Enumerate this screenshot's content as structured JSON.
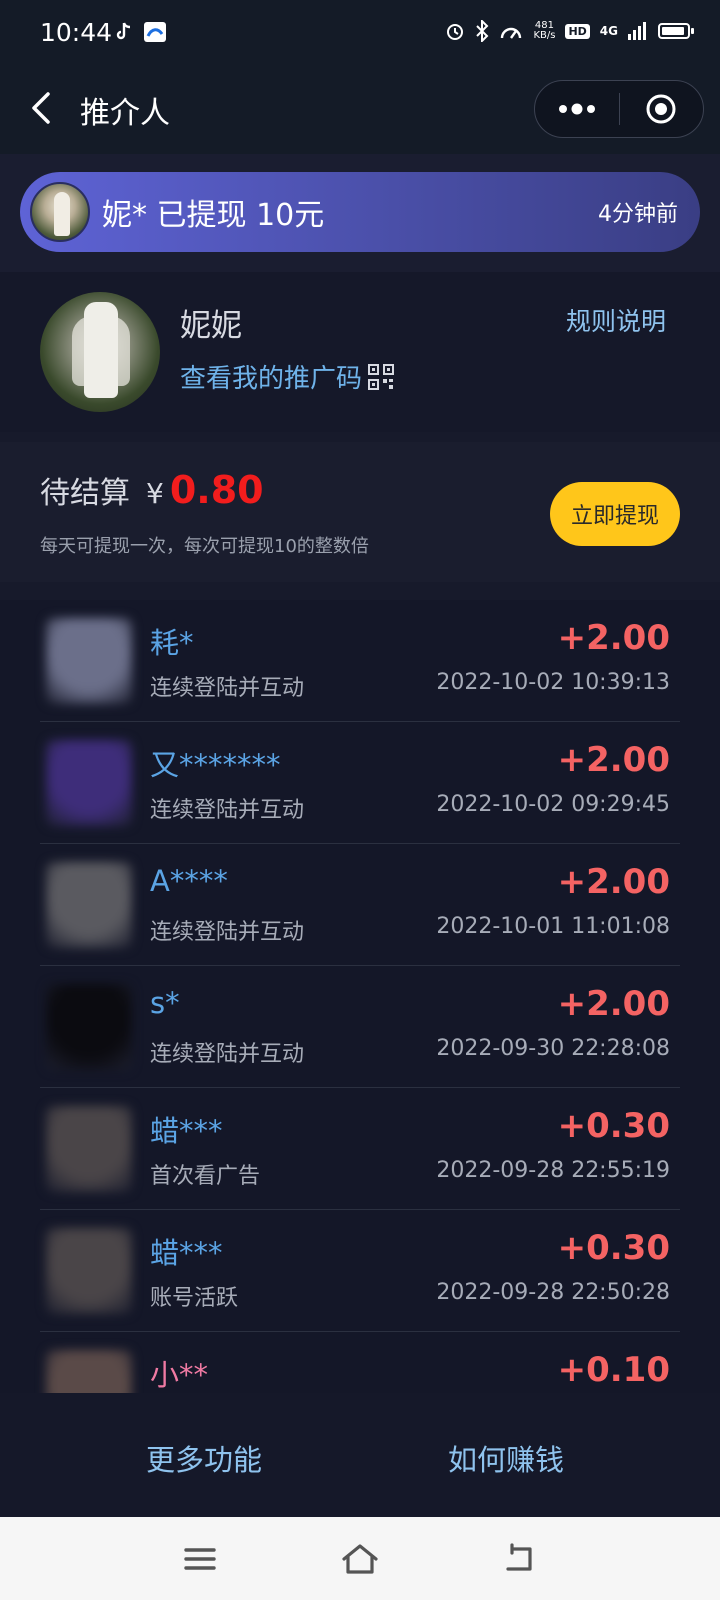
{
  "status_bar": {
    "time": "10:44",
    "net_speed_value": "481",
    "net_speed_unit": "KB/s",
    "hd": "HD",
    "network": "4G"
  },
  "nav": {
    "title": "推介人",
    "back_icon": "chevron-left-icon",
    "more_icon": "more-dots-icon",
    "target_icon": "target-icon"
  },
  "notice": {
    "text": "妮* 已提现 10元",
    "time": "4分钟前"
  },
  "profile": {
    "name": "妮妮",
    "promo_link": "查看我的推广码",
    "rules_link": "规则说明"
  },
  "balance": {
    "label": "待结算",
    "currency": "¥",
    "amount": "0.80",
    "note": "每天可提现一次，每次可提现10的整数倍",
    "withdraw_label": "立即提现",
    "withdraw_color": "#ffc61a",
    "amount_color": "#f21d1d"
  },
  "records": [
    {
      "name": "耗*",
      "desc": "连续登陆并互动",
      "amount": "+2.00",
      "time": "2022-10-02 10:39:13",
      "avatar_color": "#6b6f8a"
    },
    {
      "name": "又*******",
      "desc": "连续登陆并互动",
      "amount": "+2.00",
      "time": "2022-10-02 09:29:45",
      "avatar_color": "#3e2d7a"
    },
    {
      "name": "A****",
      "desc": "连续登陆并互动",
      "amount": "+2.00",
      "time": "2022-10-01 11:01:08",
      "avatar_color": "#5a5a60"
    },
    {
      "name": "s*",
      "desc": "连续登陆并互动",
      "amount": "+2.00",
      "time": "2022-09-30 22:28:08",
      "avatar_color": "#0b0b10"
    },
    {
      "name": "蜡***",
      "desc": "首次看广告",
      "amount": "+0.30",
      "time": "2022-09-28 22:55:19",
      "avatar_color": "#4a4548"
    },
    {
      "name": "蜡***",
      "desc": "账号活跃",
      "amount": "+0.30",
      "time": "2022-09-28 22:50:28",
      "avatar_color": "#4a4548"
    },
    {
      "name": "小**",
      "desc": "",
      "amount": "+0.10",
      "time": "",
      "avatar_color": "#5a4a48",
      "name_color": "#f07aa3"
    }
  ],
  "bottom": {
    "more_features": "更多功能",
    "how_to_earn": "如何赚钱"
  },
  "system_nav": {
    "menu_icon": "menu-icon",
    "home_icon": "home-icon",
    "back_icon": "back-arrow-icon"
  }
}
